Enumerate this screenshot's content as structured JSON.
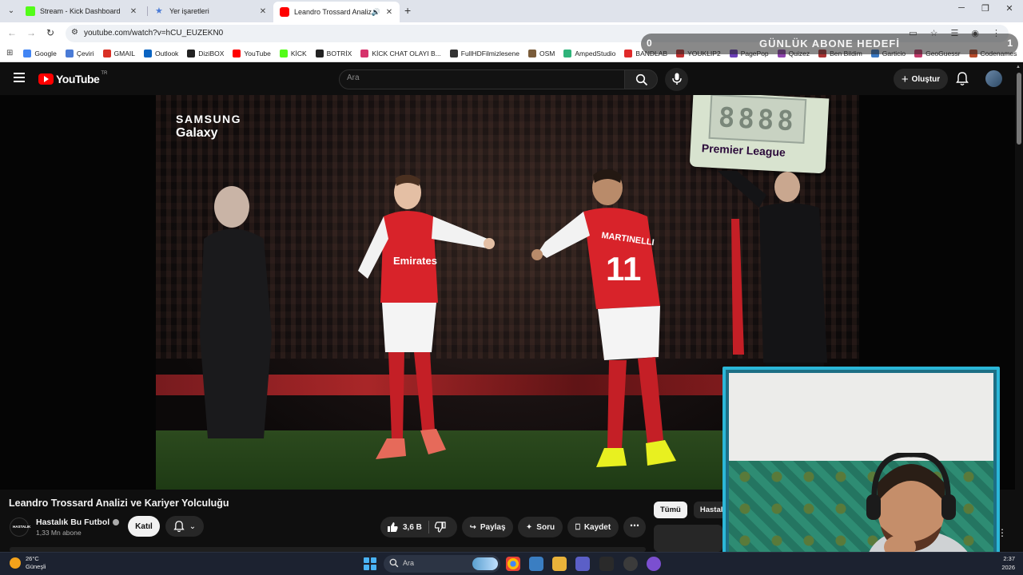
{
  "browser": {
    "tabs": [
      {
        "title": "Stream - Kick Dashboard",
        "favicon_color": "#53fc18"
      },
      {
        "title": "Yer işaretleri",
        "favicon_color": "#4a7bd6"
      },
      {
        "title": "Leandro Trossard Analizi ve",
        "favicon_color": "#ff0000",
        "active": true
      }
    ],
    "url": "youtube.com/watch?v=hCU_EUZEKN0",
    "bookmarks": [
      {
        "label": "Google",
        "color": "#4285f4"
      },
      {
        "label": "Çeviri",
        "color": "#4a7bd6"
      },
      {
        "label": "GMAIL",
        "color": "#d93025"
      },
      {
        "label": "Outlook",
        "color": "#0a64c2"
      },
      {
        "label": "DiziBOX",
        "color": "#222222"
      },
      {
        "label": "YouTube",
        "color": "#ff0000"
      },
      {
        "label": "KİCK",
        "color": "#53fc18"
      },
      {
        "label": "BOTRİX",
        "color": "#222222"
      },
      {
        "label": "KİCK CHAT OLAYI B...",
        "color": "#d6336c"
      },
      {
        "label": "FullHDFilmizlesene",
        "color": "#333333"
      },
      {
        "label": "OSM",
        "color": "#7a5c3a"
      },
      {
        "label": "AmpedStudio",
        "color": "#2fb37a"
      },
      {
        "label": "BANDLAB",
        "color": "#e02a2a"
      },
      {
        "label": "YOUKLIP2",
        "color": "#c03030"
      },
      {
        "label": "PagePop",
        "color": "#6c3fb8"
      },
      {
        "label": "Quizez",
        "color": "#8e44ad"
      },
      {
        "label": "Ben Bildim",
        "color": "#aa3333"
      },
      {
        "label": "Garticio",
        "color": "#3a78c2"
      },
      {
        "label": "GeoGuessr",
        "color": "#c23a6a"
      },
      {
        "label": "Codenames",
        "color": "#b54a2a"
      }
    ]
  },
  "overlay": {
    "goal_current": "0",
    "goal_label": "GÜNLÜK ABONE HEDEFİ",
    "goal_target": "1"
  },
  "youtube": {
    "logo_text": "YouTube",
    "country": "TR",
    "search_placeholder": "Ara",
    "create_label": "Oluştur",
    "video": {
      "sponsor_line1": "SAMSUNG",
      "sponsor_line2": "Galaxy",
      "board_label": "Premier League",
      "board_digits": "8888"
    },
    "title": "Leandro Trossard Analizi ve Kariyer Yolculuğu",
    "channel": {
      "name": "Hastalık Bu Futbol",
      "avatar_text": "HASTALIK",
      "subscribers": "1,33 Mn abone",
      "join_label": "Katıl"
    },
    "actions": {
      "likes": "3,6 B",
      "share": "Paylaş",
      "ask": "Soru",
      "save": "Kaydet"
    },
    "chips": [
      "Tümü",
      "Hastalık"
    ]
  },
  "taskbar": {
    "temperature": "26°C",
    "weather": "Güneşli",
    "search_placeholder": "Ara",
    "time": "2:37",
    "date": "2026"
  }
}
